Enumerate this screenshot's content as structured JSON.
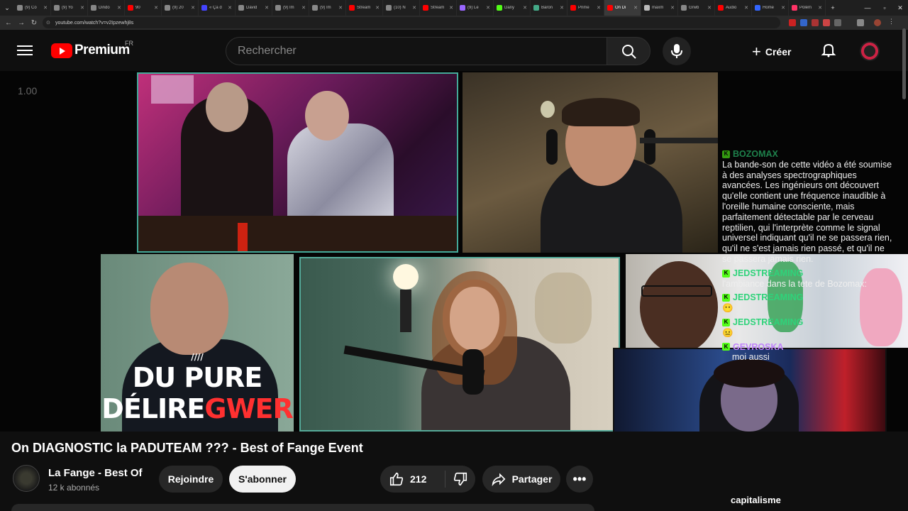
{
  "browser": {
    "tabs": [
      {
        "label": "(9) Co",
        "color": "#888888"
      },
      {
        "label": "(9) Yo",
        "color": "#888888"
      },
      {
        "label": "Dindo",
        "color": "#888888"
      },
      {
        "label": "90",
        "color": "#ff0000"
      },
      {
        "label": "(9) 20",
        "color": "#888888"
      },
      {
        "label": "« Ça d",
        "color": "#4444ff"
      },
      {
        "label": "David",
        "color": "#888888"
      },
      {
        "label": "(9) Im",
        "color": "#888888"
      },
      {
        "label": "(9) Im",
        "color": "#888888"
      },
      {
        "label": "Stream",
        "color": "#ff0000"
      },
      {
        "label": "(10) N",
        "color": "#888888"
      },
      {
        "label": "Stream",
        "color": "#ff0000"
      },
      {
        "label": "(9) Le",
        "color": "#9966ff"
      },
      {
        "label": "Dany",
        "color": "#53fc18"
      },
      {
        "label": "Baron",
        "color": "#44aa88"
      },
      {
        "label": "Prime",
        "color": "#ff0000"
      },
      {
        "label": "On Di",
        "color": "#ff0000",
        "active": true
      },
      {
        "label": "maxm",
        "color": "#bbbbbb"
      },
      {
        "label": "Grwb",
        "color": "#888888"
      },
      {
        "label": "Audio",
        "color": "#ff0000"
      },
      {
        "label": "Home",
        "color": "#3366ff"
      },
      {
        "label": "Polém",
        "color": "#ff3366"
      }
    ],
    "url": "youtube.com/watch?v=v2Ipzewhj8s"
  },
  "header": {
    "logo_text": "Premium",
    "country": "FR",
    "search_placeholder": "Rechercher",
    "create_label": "Créer"
  },
  "player": {
    "speed": "1.00"
  },
  "chat": {
    "messages": [
      {
        "user": "BOZOMAX",
        "text": "La bande-son de cette vidéo a été soumise à des analyses spectrographiques avancées. Les ingénieurs ont découvert qu'elle contient une fréquence inaudible à l'oreille humaine consciente, mais parfaitement détectable par le cerveau reptilien, qui l'interprète comme le signal universel indiquant qu'il ne se passera rien, qu'il ne s'est jamais rien passé, et qu'il ne se passera jamais rien."
      },
      {
        "user": "JEDSTREAMING",
        "text": "l'ambiance dans la tete de Bozomax:"
      },
      {
        "user": "JEDSTREAMING",
        "text": "😶"
      },
      {
        "user": "JEDSTREAMING",
        "text": "😐"
      },
      {
        "user": "GEVROSKA",
        "text": "moi aussi"
      }
    ]
  },
  "video": {
    "title": "On DIAGNOSTIC la PADUTEAM ??? - Best of Fange Event",
    "channel_name": "La Fange - Best Of",
    "subscribers": "12 k abonnés",
    "join_label": "Rejoindre",
    "subscribe_label": "S'abonner",
    "likes": "212",
    "share_label": "Partager",
    "overlay_text_line1": "DU PURE",
    "overlay_text_line2a": "DÉLIRE",
    "overlay_text_line2b": "GWER",
    "caption": "capitalisme"
  },
  "colors": {
    "yt_red": "#ff0000",
    "kick_green": "#53fc18",
    "chat_username": "#2fd37a"
  }
}
